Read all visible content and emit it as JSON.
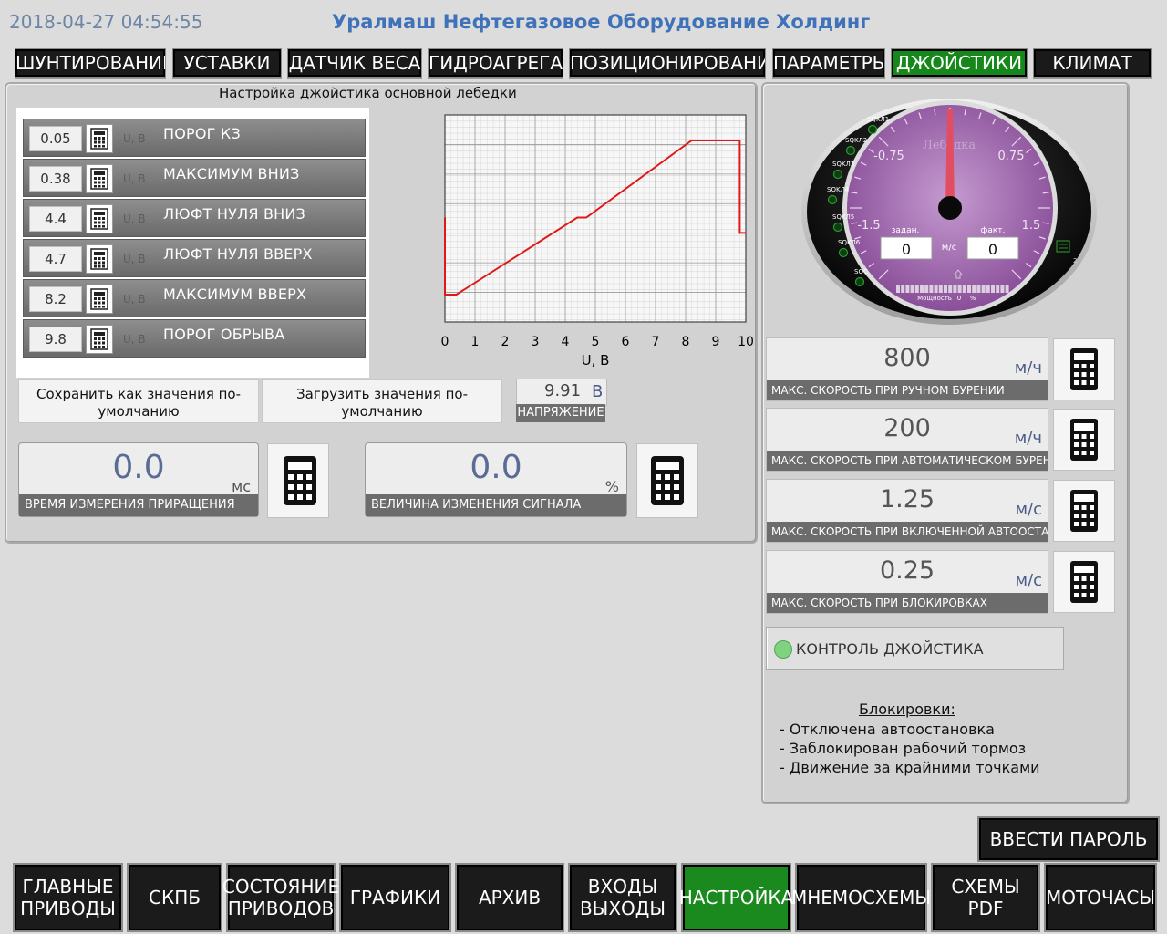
{
  "header": {
    "datetime": "2018-04-27 04:54:55",
    "company": "Уралмаш Нефтегазовое Оборудование Холдинг"
  },
  "top_nav": [
    {
      "label": "ШУНТИРОВАНИЕ",
      "active": false
    },
    {
      "label": "УСТАВКИ",
      "active": false
    },
    {
      "label": "ДАТЧИК ВЕСА",
      "active": false
    },
    {
      "label": "ГИДРОАГРЕГАТ",
      "active": false
    },
    {
      "label": "ПОЗИЦИОНИРОВАНИЕ",
      "active": false
    },
    {
      "label": "ПАРАМЕТРЫ",
      "active": false
    },
    {
      "label": "ДЖОЙСТИКИ",
      "active": true
    },
    {
      "label": "КЛИМАТ",
      "active": false
    }
  ],
  "joystick": {
    "title": "Настройка джойстика основной лебедки",
    "rows": [
      {
        "value": "0.05",
        "unit": "U, В",
        "label": "ПОРОГ КЗ"
      },
      {
        "value": "0.38",
        "unit": "U, В",
        "label": "МАКСИМУМ ВНИЗ"
      },
      {
        "value": "4.4",
        "unit": "U, В",
        "label": "ЛЮФТ НУЛЯ ВНИЗ"
      },
      {
        "value": "4.7",
        "unit": "U, В",
        "label": "ЛЮФТ НУЛЯ ВВЕРХ"
      },
      {
        "value": "8.2",
        "unit": "U, В",
        "label": "МАКСИМУМ ВВЕРХ"
      },
      {
        "value": "9.8",
        "unit": "U, В",
        "label": "ПОРОГ ОБРЫВА"
      }
    ],
    "save_default_label": "Сохранить как значения по-умолчанию",
    "load_default_label": "Загрузить значения по-умолчанию",
    "voltage_value": "9.91",
    "voltage_unit": "В",
    "voltage_label": "НАПРЯЖЕНИЕ"
  },
  "chart_data": {
    "type": "line",
    "xlabel": "U, В",
    "xlim": [
      0,
      10
    ],
    "x_ticks": [
      "0",
      "1",
      "2",
      "3",
      "4",
      "5",
      "6",
      "7",
      "8",
      "9",
      "10"
    ],
    "grid": true,
    "series": [
      {
        "color": "#e01818",
        "x": [
          0.0,
          0.0,
          0.38,
          4.4,
          4.7,
          8.2,
          9.8,
          9.8,
          10.0
        ],
        "y": [
          0.5,
          0.0,
          0.0,
          0.5,
          0.5,
          1.0,
          1.0,
          0.4,
          0.4
        ]
      }
    ]
  },
  "bottom_fields": [
    {
      "value": "0.0",
      "unit": "мс",
      "label": "ВРЕМЯ ИЗМЕРЕНИЯ ПРИРАЩЕНИЯ"
    },
    {
      "value": "0.0",
      "unit": "%",
      "label": "ВЕЛИЧИНА ИЗМЕНЕНИЯ СИГНАЛА"
    }
  ],
  "gauge": {
    "title": "Лебедка",
    "scale_labels": [
      "-0.75",
      "0.75",
      "-1.5",
      "1.5"
    ],
    "limit_labels": [
      "SQKЛ1",
      "SQKЛ2",
      "SQKЛ3",
      "SQKЛ4",
      "SQKЛ5",
      "SQKЛ6",
      "SQC"
    ],
    "set_label": "задан.",
    "actual_label": "факт.",
    "unit": "м/с",
    "set_value": "0",
    "actual_value": "0",
    "power_label": "Мощность",
    "power_value": "0",
    "power_unit": "%",
    "brake_index": "2",
    "needle_value": 0
  },
  "speed_fields": [
    {
      "value": "800",
      "unit": "м/ч",
      "label": "МАКС. СКОРОСТЬ ПРИ РУЧНОМ БУРЕНИИ"
    },
    {
      "value": "200",
      "unit": "м/ч",
      "label": "МАКС. СКОРОСТЬ ПРИ АВТОМАТИЧЕСКОМ БУРЕНИИ"
    },
    {
      "value": "1.25",
      "unit": "м/с",
      "label": "МАКС. СКОРОСТЬ ПРИ ВКЛЮЧЕННОЙ АВТООСТАНОВКЕ"
    },
    {
      "value": "0.25",
      "unit": "м/с",
      "label": "МАКС. СКОРОСТЬ ПРИ БЛОКИРОВКАХ"
    }
  ],
  "joystick_control_label": "КОНТРОЛЬ ДЖОЙСТИКА",
  "blocks": {
    "title": "Блокировки:",
    "items": [
      "- Отключена автоостановка",
      "- Заблокирован рабочий тормоз",
      "- Движение за крайними точками"
    ]
  },
  "password_button": "ВВЕСТИ ПАРОЛЬ",
  "bottom_nav": [
    {
      "label": "ГЛАВНЫЕ ПРИВОДЫ",
      "active": false
    },
    {
      "label": "СКПБ",
      "active": false
    },
    {
      "label": "СОСТОЯНИЕ ПРИВОДОВ",
      "active": false
    },
    {
      "label": "ГРАФИКИ",
      "active": false
    },
    {
      "label": "АРХИВ",
      "active": false
    },
    {
      "label": "ВХОДЫ ВЫХОДЫ",
      "active": false
    },
    {
      "label": "НАСТРОЙКА",
      "active": true
    },
    {
      "label": "МНЕМОСХЕМЫ",
      "active": false
    },
    {
      "label": "СХЕМЫ PDF",
      "active": false
    },
    {
      "label": "МОТОЧАСЫ",
      "active": false
    }
  ]
}
